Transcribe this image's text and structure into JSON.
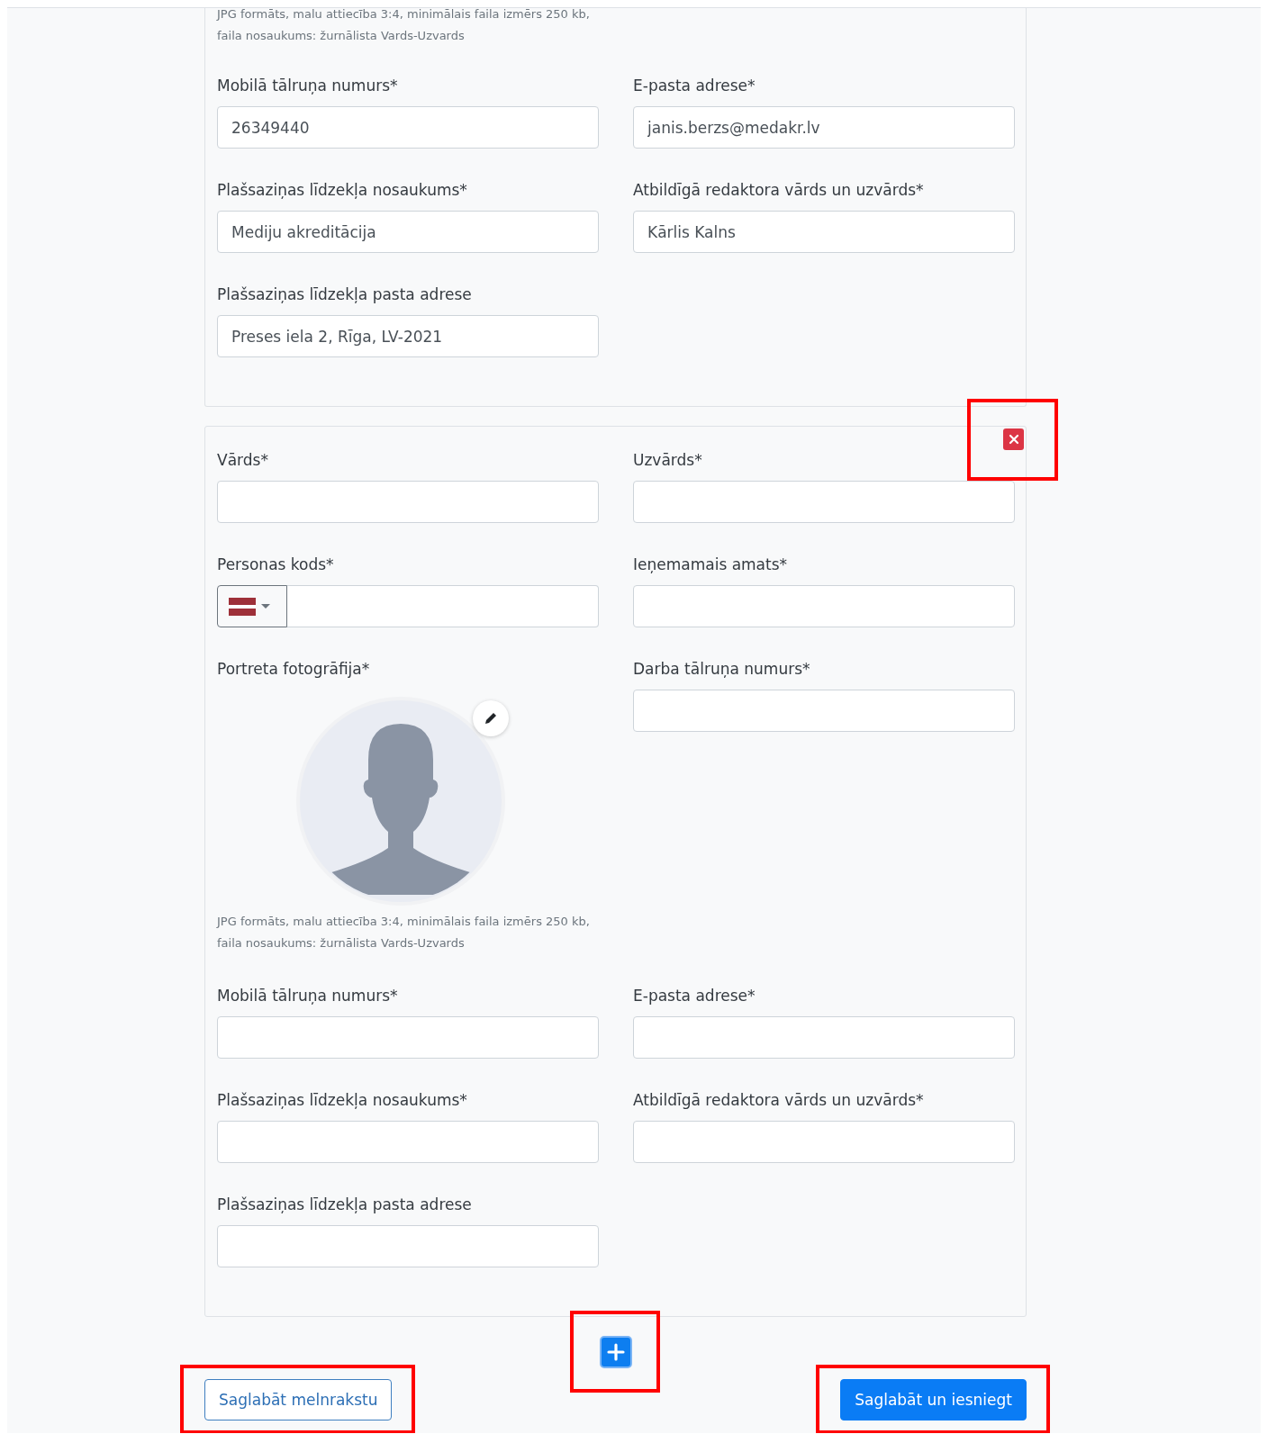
{
  "forms": [
    {
      "items": [
        {
          "kind": "hint",
          "text": "JPG formāts, malu attiecība 3:4, minimālais faila izmērs 250 kb, faila nosaukums: žurnālista Vards-Uzvards"
        },
        {
          "kind": "field",
          "label": "Mobilā tālruņa numurs*",
          "value": "26349440"
        },
        {
          "kind": "field",
          "label": "E-pasta adrese*",
          "value": "janis.berzs@medakr.lv"
        },
        {
          "kind": "field",
          "label": "Plašsaziņas līdzekļa nosaukums*",
          "value": "Mediju akreditācija"
        },
        {
          "kind": "field",
          "label": "Atbildīgā redaktora vārds un uzvārds*",
          "value": "Kārlis Kalns"
        },
        {
          "kind": "field",
          "label": "Plašsaziņas līdzekļa pasta adrese",
          "value": "Preses iela 2, Rīga, LV-2021"
        }
      ]
    },
    {
      "remove": {
        "highlighted": true
      },
      "items": [
        {
          "kind": "field",
          "label": "Vārds*"
        },
        {
          "kind": "field",
          "label": "Uzvārds*"
        },
        {
          "kind": "code",
          "label": "Personas kods*"
        },
        {
          "kind": "field",
          "label": "Ieņemamais amats*"
        },
        {
          "kind": "photo",
          "label": "Portreta fotogrāfija*",
          "hint": "JPG formāts, malu attiecība 3:4, minimālais faila izmērs 250 kb, faila nosaukums: žurnālista Vards-Uzvards"
        },
        {
          "kind": "field",
          "label": "Darba tālruņa numurs*"
        },
        {
          "kind": "field",
          "label": "Mobilā tālruņa numurs*"
        },
        {
          "kind": "field",
          "label": "E-pasta adrese*"
        },
        {
          "kind": "field",
          "label": "Plašsaziņas līdzekļa nosaukums*"
        },
        {
          "kind": "field",
          "label": "Atbildīgā redaktora vārds un uzvārds*"
        },
        {
          "kind": "field",
          "label": "Plašsaziņas līdzekļa pasta adrese"
        }
      ]
    }
  ],
  "add_button": {
    "highlighted": true
  },
  "actions": [
    {
      "label": "Saglabāt melnrakstu",
      "kind": "outline",
      "highlighted": true
    },
    {
      "label": "Saglabāt un iesniegt",
      "kind": "primary",
      "highlighted": true
    }
  ]
}
